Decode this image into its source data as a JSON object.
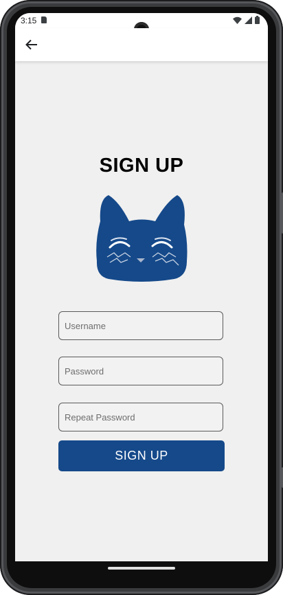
{
  "status_bar": {
    "time": "3:15",
    "icons": [
      "sd-card-icon",
      "wifi-icon",
      "cell-signal-icon",
      "battery-icon"
    ]
  },
  "app_bar": {
    "back_icon": "arrow-left-icon"
  },
  "page": {
    "title": "SIGN UP",
    "logo": "cat-face-logo"
  },
  "form": {
    "username_placeholder": "Username",
    "password_placeholder": "Password",
    "repeat_password_placeholder": "Repeat Password",
    "username_value": "",
    "password_value": "",
    "repeat_password_value": "",
    "submit_label": "SIGN UP"
  },
  "colors": {
    "primary": "#15498a",
    "background": "#f0f0f0",
    "app_bar": "#ffffff"
  }
}
